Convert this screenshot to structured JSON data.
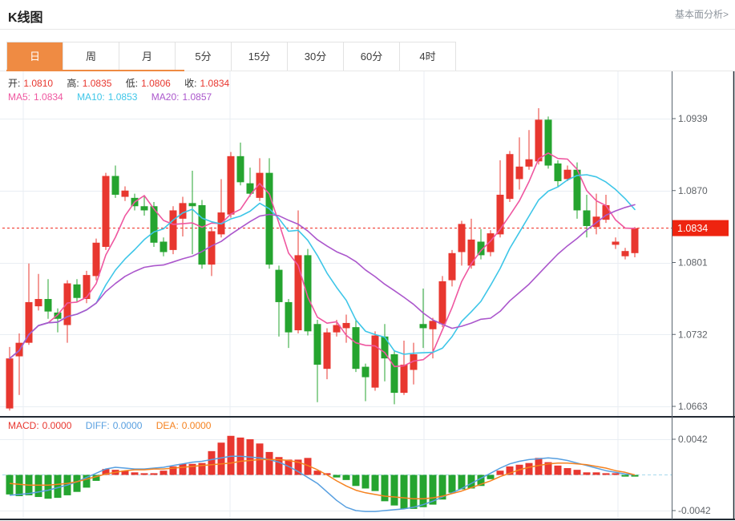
{
  "page": {
    "title": "K线图",
    "analysis_link": "基本面分析>"
  },
  "tabs": {
    "items": [
      "日",
      "周",
      "月",
      "5分",
      "15分",
      "30分",
      "60分",
      "4时"
    ],
    "active_index": 0
  },
  "legend": {
    "ohlc": {
      "open_label": "开:",
      "open": "1.0810",
      "high_label": "高:",
      "high": "1.0835",
      "low_label": "低:",
      "low": "1.0806",
      "close_label": "收:",
      "close": "1.0834"
    },
    "ma": {
      "ma5_label": "MA5:",
      "ma5": "1.0834",
      "ma10_label": "MA10:",
      "ma10": "1.0853",
      "ma20_label": "MA20:",
      "ma20": "1.0857"
    },
    "macd": {
      "macd_label": "MACD:",
      "macd": "0.0000",
      "diff_label": "DIFF:",
      "diff": "0.0000",
      "dea_label": "DEA:",
      "dea": "0.0000"
    }
  },
  "colors": {
    "up": "#e8372f",
    "down": "#25a42f",
    "ma5": "#ef57a0",
    "ma10": "#3ec6e8",
    "ma20": "#ab57cc",
    "diff_line": "#579fe0",
    "dea_line": "#f5821f",
    "accent_tab": "#ef8b43",
    "price_tag": "#ee2410",
    "price_dotted": "#f0261a",
    "zero_dashed": "#a6d9ec",
    "grid": "#e9eef3",
    "frame_dark": "#222a33",
    "axis_line": "#5a646e",
    "axis_text": "#5f6368",
    "label_text": "#333333"
  },
  "chart_data": {
    "type": "candlestick",
    "title": "K线图",
    "legend_position": "top-left-overlay",
    "grid": true,
    "price_axis": {
      "side": "right",
      "ticks": [
        1.0939,
        1.087,
        1.0801,
        1.0732,
        1.0663
      ],
      "current_price": 1.0834
    },
    "ma_periods": [
      5,
      10,
      20
    ],
    "candles": [
      [
        1.0661,
        1.072,
        1.0659,
        1.0709
      ],
      [
        1.0711,
        1.0733,
        1.0674,
        1.0724
      ],
      [
        1.0724,
        1.08,
        1.0722,
        1.0763
      ],
      [
        1.0759,
        1.079,
        1.0755,
        1.0766
      ],
      [
        1.0766,
        1.0785,
        1.0747,
        1.0754
      ],
      [
        1.0753,
        1.0757,
        1.0734,
        1.0747
      ],
      [
        1.0741,
        1.0784,
        1.0724,
        1.0781
      ],
      [
        1.078,
        1.0785,
        1.0763,
        1.0767
      ],
      [
        1.0766,
        1.0793,
        1.0762,
        1.0789
      ],
      [
        1.0788,
        1.0824,
        1.0784,
        1.082
      ],
      [
        1.0816,
        1.0887,
        1.0813,
        1.0884
      ],
      [
        1.0884,
        1.0894,
        1.0863,
        1.0866
      ],
      [
        1.0864,
        1.0874,
        1.086,
        1.087
      ],
      [
        1.0863,
        1.0867,
        1.0851,
        1.0855
      ],
      [
        1.0855,
        1.0864,
        1.0846,
        1.0851
      ],
      [
        1.0855,
        1.0859,
        1.0816,
        1.082
      ],
      [
        1.0821,
        1.0825,
        1.0807,
        1.0811
      ],
      [
        1.0813,
        1.0855,
        1.0809,
        1.0851
      ],
      [
        1.0843,
        1.0864,
        1.0826,
        1.0858
      ],
      [
        1.0858,
        1.0889,
        1.0809,
        1.0855
      ],
      [
        1.0856,
        1.0861,
        1.0795,
        1.0799
      ],
      [
        1.0799,
        1.0835,
        1.0788,
        1.0831
      ],
      [
        1.0828,
        1.0881,
        1.0825,
        1.0849
      ],
      [
        1.0847,
        1.0907,
        1.0844,
        1.0903
      ],
      [
        1.0903,
        1.0916,
        1.0875,
        1.0878
      ],
      [
        1.0877,
        1.0892,
        1.0864,
        1.0867
      ],
      [
        1.0863,
        1.0901,
        1.086,
        1.0887
      ],
      [
        1.0887,
        1.0901,
        1.0795,
        1.0799
      ],
      [
        1.0794,
        1.0798,
        1.073,
        1.0763
      ],
      [
        1.0763,
        1.0766,
        1.0719,
        1.0734
      ],
      [
        1.0736,
        1.0851,
        1.0733,
        1.0808
      ],
      [
        1.0808,
        1.0814,
        1.0731,
        1.0735
      ],
      [
        1.0742,
        1.0746,
        1.0667,
        1.0703
      ],
      [
        1.0699,
        1.0738,
        1.0689,
        1.0734
      ],
      [
        1.0734,
        1.0746,
        1.073,
        1.0741
      ],
      [
        1.0738,
        1.0751,
        1.0724,
        1.0743
      ],
      [
        1.0739,
        1.0747,
        1.0696,
        1.0699
      ],
      [
        1.0701,
        1.0704,
        1.0668,
        1.0691
      ],
      [
        1.0681,
        1.0735,
        1.0678,
        1.0731
      ],
      [
        1.073,
        1.0742,
        1.0687,
        1.0709
      ],
      [
        1.0713,
        1.0717,
        1.0665,
        1.0676
      ],
      [
        1.0676,
        1.0726,
        1.0674,
        1.0703
      ],
      [
        1.0698,
        1.0724,
        1.0684,
        1.0713
      ],
      [
        1.0742,
        1.0776,
        1.0719,
        1.0738
      ],
      [
        1.0737,
        1.0748,
        1.0709,
        1.0745
      ],
      [
        1.0742,
        1.0788,
        1.0739,
        1.0783
      ],
      [
        1.0784,
        1.0813,
        1.0778,
        1.081
      ],
      [
        1.0811,
        1.0841,
        1.0798,
        1.0838
      ],
      [
        1.0798,
        1.0843,
        1.0795,
        1.0823
      ],
      [
        1.0821,
        1.0833,
        1.0804,
        1.0808
      ],
      [
        1.0811,
        1.0832,
        1.0807,
        1.0829
      ],
      [
        1.0828,
        1.0899,
        1.0825,
        1.0866
      ],
      [
        1.0862,
        1.0908,
        1.0859,
        1.0905
      ],
      [
        1.0881,
        1.0921,
        1.0871,
        1.0893
      ],
      [
        1.0893,
        1.0928,
        1.089,
        1.09
      ],
      [
        1.0898,
        1.0949,
        1.0895,
        1.0938
      ],
      [
        1.0938,
        1.0941,
        1.0891,
        1.0894
      ],
      [
        1.0896,
        1.0899,
        1.0873,
        1.0879
      ],
      [
        1.0881,
        1.0894,
        1.0879,
        1.089
      ],
      [
        1.089,
        1.0897,
        1.0843,
        1.0851
      ],
      [
        1.0851,
        1.0866,
        1.0825,
        1.0836
      ],
      [
        1.0835,
        1.0867,
        1.0828,
        1.0845
      ],
      [
        1.0842,
        1.0866,
        1.0839,
        1.0856
      ],
      [
        1.0818,
        1.0825,
        1.0814,
        1.0821
      ],
      [
        1.0807,
        1.0815,
        1.0804,
        1.0812
      ],
      [
        1.081,
        1.0835,
        1.0806,
        1.0834
      ]
    ],
    "macd_panel": {
      "ticks": [
        0.0042,
        -0.0042
      ],
      "hist": [
        -0.0023,
        -0.0025,
        -0.0024,
        -0.0026,
        -0.0028,
        -0.0027,
        -0.0024,
        -0.002,
        -0.0015,
        -0.0007,
        0.0007,
        0.0006,
        0.0005,
        0.0003,
        0.0002,
        0.0002,
        0.0005,
        0.001,
        0.0013,
        0.0013,
        0.0014,
        0.0028,
        0.0038,
        0.0046,
        0.0044,
        0.0042,
        0.0037,
        0.0027,
        0.0021,
        0.0018,
        0.0018,
        0.002,
        0.0005,
        0.0002,
        -0.0003,
        -0.0006,
        -0.0013,
        -0.0016,
        -0.0019,
        -0.0031,
        -0.0036,
        -0.004,
        -0.004,
        -0.0038,
        -0.0035,
        -0.0029,
        -0.0021,
        -0.0017,
        -0.0016,
        -0.0013,
        -0.0005,
        0.0005,
        0.001,
        0.0012,
        0.0014,
        0.002,
        0.0015,
        0.0011,
        0.0008,
        0.0006,
        0.0003,
        0.0003,
        0.0002,
        0.0002,
        -0.0002,
        -0.0002
      ],
      "diff": [
        -0.0024,
        -0.0023,
        -0.0022,
        -0.002,
        -0.0018,
        -0.0015,
        -0.0012,
        -0.0008,
        -0.0003,
        0.0002,
        0.0007,
        0.0009,
        0.0008,
        0.0007,
        0.0007,
        0.0008,
        0.0009,
        0.0011,
        0.0013,
        0.0015,
        0.0016,
        0.0018,
        0.002,
        0.0022,
        0.0022,
        0.0021,
        0.002,
        0.0018,
        0.0015,
        0.001,
        0.0004,
        -0.0003,
        -0.001,
        -0.002,
        -0.003,
        -0.0038,
        -0.0042,
        -0.0043,
        -0.0043,
        -0.0042,
        -0.0041,
        -0.004,
        -0.0038,
        -0.0035,
        -0.0031,
        -0.0026,
        -0.0021,
        -0.0016,
        -0.001,
        -0.0004,
        0.0002,
        0.0008,
        0.0013,
        0.0016,
        0.0018,
        0.0019,
        0.002,
        0.0019,
        0.0017,
        0.0014,
        0.0011,
        0.0008,
        0.0005,
        0.0003,
        0.0001,
        0.0
      ],
      "dea": [
        -0.001,
        -0.0011,
        -0.0012,
        -0.0012,
        -0.0012,
        -0.0011,
        -0.001,
        -0.0008,
        -0.0005,
        -0.0002,
        0.0001,
        0.0003,
        0.0005,
        0.0006,
        0.0006,
        0.0007,
        0.0007,
        0.0008,
        0.0009,
        0.001,
        0.0011,
        0.0012,
        0.0013,
        0.0014,
        0.0016,
        0.0017,
        0.0018,
        0.0018,
        0.0018,
        0.0017,
        0.0015,
        0.0011,
        0.0006,
        0.0,
        -0.0007,
        -0.0013,
        -0.0018,
        -0.0021,
        -0.0023,
        -0.0025,
        -0.0026,
        -0.0027,
        -0.0028,
        -0.0028,
        -0.0027,
        -0.0025,
        -0.0022,
        -0.0019,
        -0.0015,
        -0.0011,
        -0.0007,
        -0.0002,
        0.0002,
        0.0006,
        0.0009,
        0.0011,
        0.0013,
        0.0014,
        0.0014,
        0.0013,
        0.0012,
        0.001,
        0.0008,
        0.0005,
        0.0003,
        0.0
      ]
    }
  }
}
